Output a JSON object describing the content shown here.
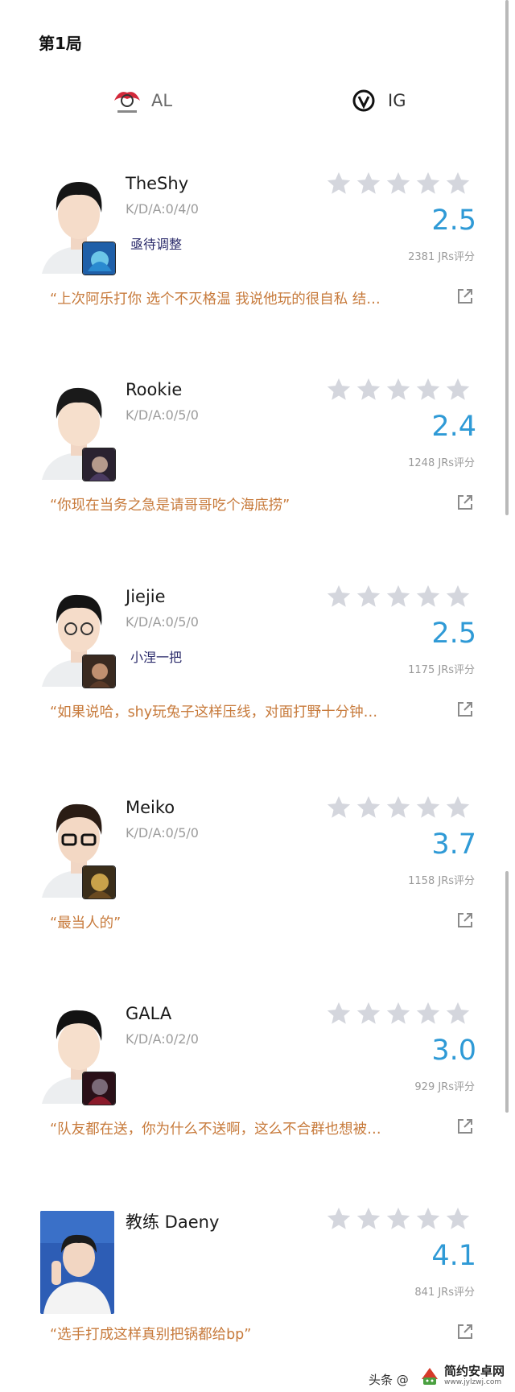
{
  "header": {
    "title": "第1局"
  },
  "teams": {
    "left": {
      "name": "AL"
    },
    "right": {
      "name": "IG"
    }
  },
  "colors": {
    "rating": "#2f9ad6",
    "quote": "#c77a3b",
    "star_empty": "#d4d6dd"
  },
  "players": [
    {
      "name": "TheShy",
      "kda": "K/D/A:0/4/0",
      "tagline": "亟待调整",
      "rating": "2.5",
      "jrs": "2381 JRs评分",
      "quote": "“上次阿乐打你 选个不灭格温 我说他玩的很自私 结…"
    },
    {
      "name": "Rookie",
      "kda": "K/D/A:0/5/0",
      "tagline": "",
      "rating": "2.4",
      "jrs": "1248 JRs评分",
      "quote": "“你现在当务之急是请哥哥吃个海底捞”"
    },
    {
      "name": "Jiejie",
      "kda": "K/D/A:0/5/0",
      "tagline": "小涅一把",
      "rating": "2.5",
      "jrs": "1175 JRs评分",
      "quote": "“如果说哈，shy玩兔子这样压线，对面打野十分钟…"
    },
    {
      "name": "Meiko",
      "kda": "K/D/A:0/5/0",
      "tagline": "",
      "rating": "3.7",
      "jrs": "1158 JRs评分",
      "quote": "“最当人的”"
    },
    {
      "name": "GALA",
      "kda": "K/D/A:0/2/0",
      "tagline": "",
      "rating": "3.0",
      "jrs": "929 JRs评分",
      "quote": "“队友都在送，你为什么不送啊，这么不合群也想被…"
    },
    {
      "name": "教练 Daeny",
      "kda": "",
      "tagline": "",
      "rating": "4.1",
      "jrs": "841 JRs评分",
      "quote": "“选手打成这样真别把锅都给bp”"
    }
  ],
  "footer": {
    "text": "头条 @",
    "watermark_name": "简约安卓网",
    "watermark_url": "www.jylzwj.com"
  }
}
